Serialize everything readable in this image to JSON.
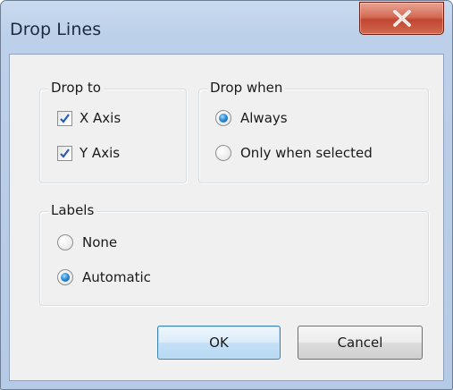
{
  "window": {
    "title": "Drop Lines"
  },
  "titlebar": {
    "close_icon": "close-x-icon",
    "close_color": "#c24631"
  },
  "drop_to": {
    "label": "Drop to",
    "options": [
      {
        "label": "X Axis",
        "checked": true
      },
      {
        "label": "Y Axis",
        "checked": true
      }
    ]
  },
  "drop_when": {
    "label": "Drop when",
    "options": [
      {
        "label": "Always",
        "selected": true
      },
      {
        "label": "Only when selected",
        "selected": false
      }
    ]
  },
  "labels": {
    "label": "Labels",
    "options": [
      {
        "label": "None",
        "selected": false
      },
      {
        "label": "Automatic",
        "selected": true
      }
    ]
  },
  "buttons": {
    "ok_label": "OK",
    "cancel_label": "Cancel"
  },
  "colors": {
    "accent": "#2f8ed8",
    "default_button_border": "#3c7fb1"
  }
}
